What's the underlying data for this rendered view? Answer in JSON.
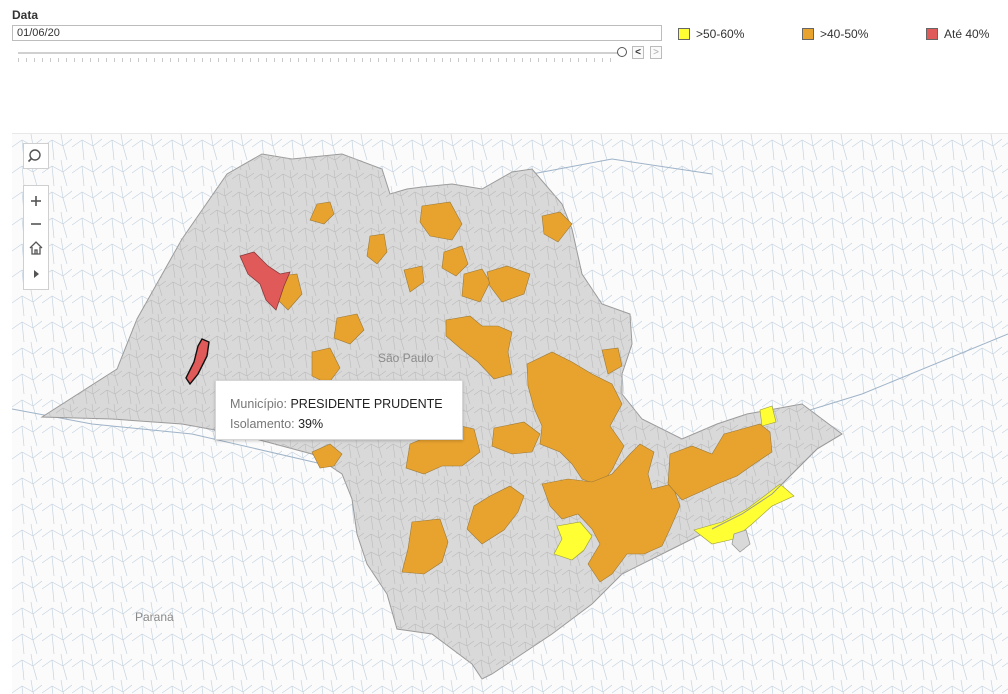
{
  "filter": {
    "title": "Data",
    "date_value": "01/06/20",
    "prev_label": "<",
    "next_label": ">"
  },
  "legend": [
    {
      "label": ">50-60%",
      "color": "#ffff33"
    },
    {
      "label": ">40-50%",
      "color": "#e8a22e"
    },
    {
      "label": "Até 40%",
      "color": "#e05a5a"
    }
  ],
  "map_controls": {
    "search_icon": "search-icon",
    "zoom_in_icon": "plus-icon",
    "zoom_out_icon": "minus-icon",
    "home_icon": "home-icon",
    "expand_icon": "play-icon"
  },
  "tooltip": {
    "municipio_label": "Município:",
    "municipio_value": "PRESIDENTE PRUDENTE",
    "isolamento_label": "Isolamento:",
    "isolamento_value": "39%"
  },
  "place_labels": {
    "sao_paulo": "São Paulo",
    "parana": "Paraná"
  },
  "colors": {
    "state_fill": "#d9d9d9",
    "neighbor_lines": "#b8c8d8",
    "orange": "#e8a22e",
    "yellow": "#ffff33",
    "red": "#e05a5a"
  }
}
